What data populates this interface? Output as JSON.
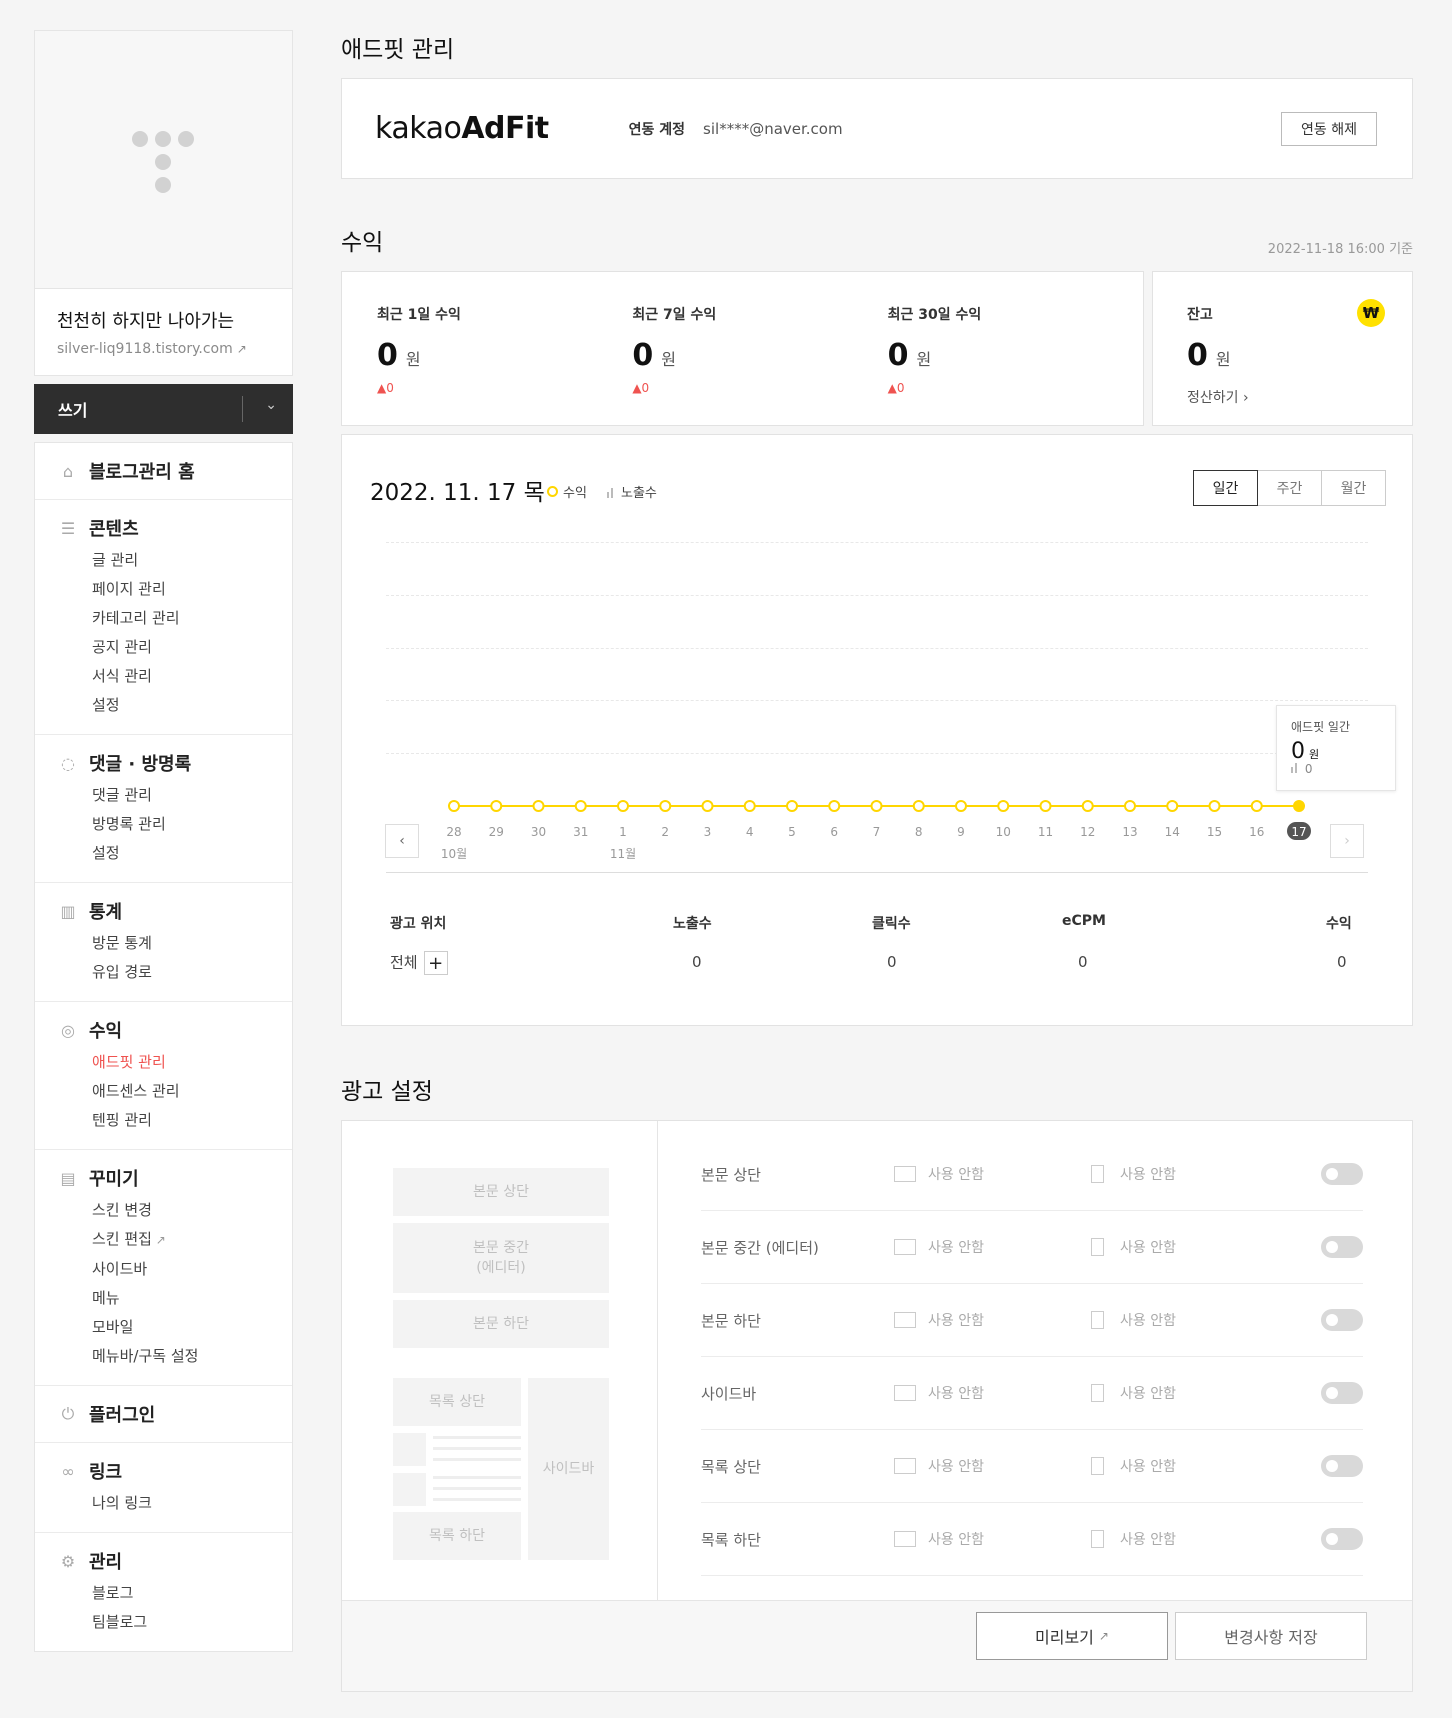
{
  "sidebar": {
    "blog_name": "천천히 하지만 나아가는",
    "blog_url": "silver-liq9118.tistory.com",
    "write_label": "쓰기",
    "groups": [
      {
        "title": "블로그관리 홈",
        "icon": "home-icon",
        "items": []
      },
      {
        "title": "콘텐츠",
        "icon": "document-icon",
        "items": [
          "글 관리",
          "페이지 관리",
          "카테고리 관리",
          "공지 관리",
          "서식 관리",
          "설정"
        ]
      },
      {
        "title": "댓글 · 방명록",
        "icon": "comment-icon",
        "items": [
          "댓글 관리",
          "방명록 관리",
          "설정"
        ]
      },
      {
        "title": "통계",
        "icon": "stats-icon",
        "items": [
          "방문 통계",
          "유입 경로"
        ]
      },
      {
        "title": "수익",
        "icon": "coins-icon",
        "items": [
          "애드핏 관리",
          "애드센스 관리",
          "텐핑 관리"
        ]
      },
      {
        "title": "꾸미기",
        "icon": "layout-icon",
        "items": [
          "스킨 변경",
          "스킨 편집",
          "사이드바",
          "메뉴",
          "모바일",
          "메뉴바/구독 설정"
        ]
      },
      {
        "title": "플러그인",
        "icon": "plug-icon",
        "items": []
      },
      {
        "title": "링크",
        "icon": "link-icon",
        "items": [
          "나의 링크"
        ]
      },
      {
        "title": "관리",
        "icon": "gear-icon",
        "items": [
          "블로그",
          "팀블로그"
        ]
      }
    ],
    "active_item": "애드핏 관리"
  },
  "adfit": {
    "page_title": "애드핏 관리",
    "logo_light": "kakao",
    "logo_bold": "AdFit",
    "account_label": "연동 계정",
    "account_value": "sil****@naver.com",
    "unlink_button": "연동 해제"
  },
  "revenue": {
    "title": "수익",
    "as_of": "2022-11-18 16:00 기준",
    "unit": "원",
    "stats": [
      {
        "label": "최근 1일 수익",
        "value": "0",
        "delta": "▲0"
      },
      {
        "label": "최근 7일 수익",
        "value": "0",
        "delta": "▲0"
      },
      {
        "label": "최근 30일 수익",
        "value": "0",
        "delta": "▲0"
      }
    ],
    "balance": {
      "label": "잔고",
      "value": "0",
      "settle_link": "정산하기 ›",
      "badge": "₩"
    }
  },
  "chart": {
    "date_title": "2022. 11. 17 목",
    "legend_revenue": "수익",
    "legend_impressions": "노출수",
    "periods": [
      "일간",
      "주간",
      "월간"
    ],
    "active_period": "일간",
    "tooltip": {
      "title": "애드핏 일간",
      "value": "0",
      "unit": "원",
      "impressions": "0"
    },
    "prev_icon": "chevron-left-icon",
    "next_icon": "chevron-right-icon",
    "month_labels": [
      {
        "label": "10월",
        "at": "28"
      },
      {
        "label": "11월",
        "at": "1"
      }
    ],
    "colors": {
      "line": "#ffd600",
      "selected_badge": "#555555"
    }
  },
  "chart_data": {
    "type": "line",
    "categories": [
      "28",
      "29",
      "30",
      "31",
      "1",
      "2",
      "3",
      "4",
      "5",
      "6",
      "7",
      "8",
      "9",
      "10",
      "11",
      "12",
      "13",
      "14",
      "15",
      "16",
      "17"
    ],
    "series": [
      {
        "name": "수익",
        "values": [
          0,
          0,
          0,
          0,
          0,
          0,
          0,
          0,
          0,
          0,
          0,
          0,
          0,
          0,
          0,
          0,
          0,
          0,
          0,
          0,
          0
        ]
      }
    ],
    "selected": "17",
    "grid": true
  },
  "table": {
    "headers": [
      "광고 위치",
      "노출수",
      "클릭수",
      "eCPM",
      "수익"
    ],
    "row_label": "전체",
    "plus": "+",
    "values": [
      "0",
      "0",
      "0",
      "0"
    ]
  },
  "ad_settings": {
    "title": "광고 설정",
    "preview": {
      "body_top": "본문 상단",
      "body_middle_1": "본문 중간",
      "body_middle_2": "(에디터)",
      "body_bottom": "본문 하단",
      "list_top": "목록 상단",
      "list_bottom": "목록 하단",
      "sidebar": "사이드바"
    },
    "rows": [
      {
        "name": "본문 상단",
        "pc": "사용 안함",
        "mobile": "사용 안함"
      },
      {
        "name": "본문 중간 (에디터)",
        "pc": "사용 안함",
        "mobile": "사용 안함"
      },
      {
        "name": "본문 하단",
        "pc": "사용 안함",
        "mobile": "사용 안함"
      },
      {
        "name": "사이드바",
        "pc": "사용 안함",
        "mobile": "사용 안함"
      },
      {
        "name": "목록 상단",
        "pc": "사용 안함",
        "mobile": "사용 안함"
      },
      {
        "name": "목록 하단",
        "pc": "사용 안함",
        "mobile": "사용 안함"
      }
    ],
    "preview_button": "미리보기",
    "save_button": "변경사항 저장"
  }
}
